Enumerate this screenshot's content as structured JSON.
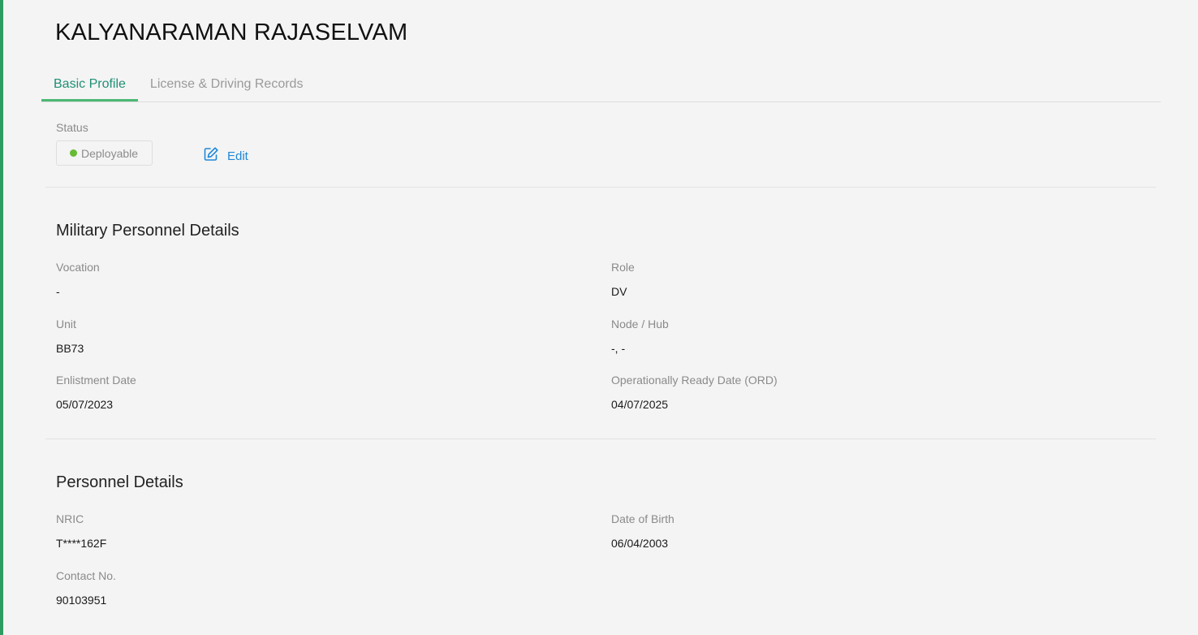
{
  "profile": {
    "name": "KALYANARAMAN RAJASELVAM"
  },
  "tabs": [
    {
      "label": "Basic Profile",
      "active": true
    },
    {
      "label": "License & Driving Records",
      "active": false
    }
  ],
  "status": {
    "label": "Status",
    "value": "Deployable",
    "dot_color": "#66bb33",
    "edit_label": "Edit"
  },
  "military": {
    "title": "Military Personnel Details",
    "fields": [
      {
        "label": "Vocation",
        "value": "-"
      },
      {
        "label": "Role",
        "value": "DV"
      },
      {
        "label": "Unit",
        "value": "BB73"
      },
      {
        "label": "Node / Hub",
        "value": "-, -"
      },
      {
        "label": "Enlistment Date",
        "value": "05/07/2023"
      },
      {
        "label": "Operationally Ready Date (ORD)",
        "value": "04/07/2025"
      }
    ]
  },
  "personnel": {
    "title": "Personnel Details",
    "fields": [
      {
        "label": "NRIC",
        "value": "T****162F"
      },
      {
        "label": "Date of Birth",
        "value": "06/04/2003"
      },
      {
        "label": "Contact No.",
        "value": "90103951"
      }
    ]
  },
  "colors": {
    "accent_green": "#2e9b62",
    "tab_active": "#1f8f74",
    "link_blue": "#1e88d8"
  }
}
